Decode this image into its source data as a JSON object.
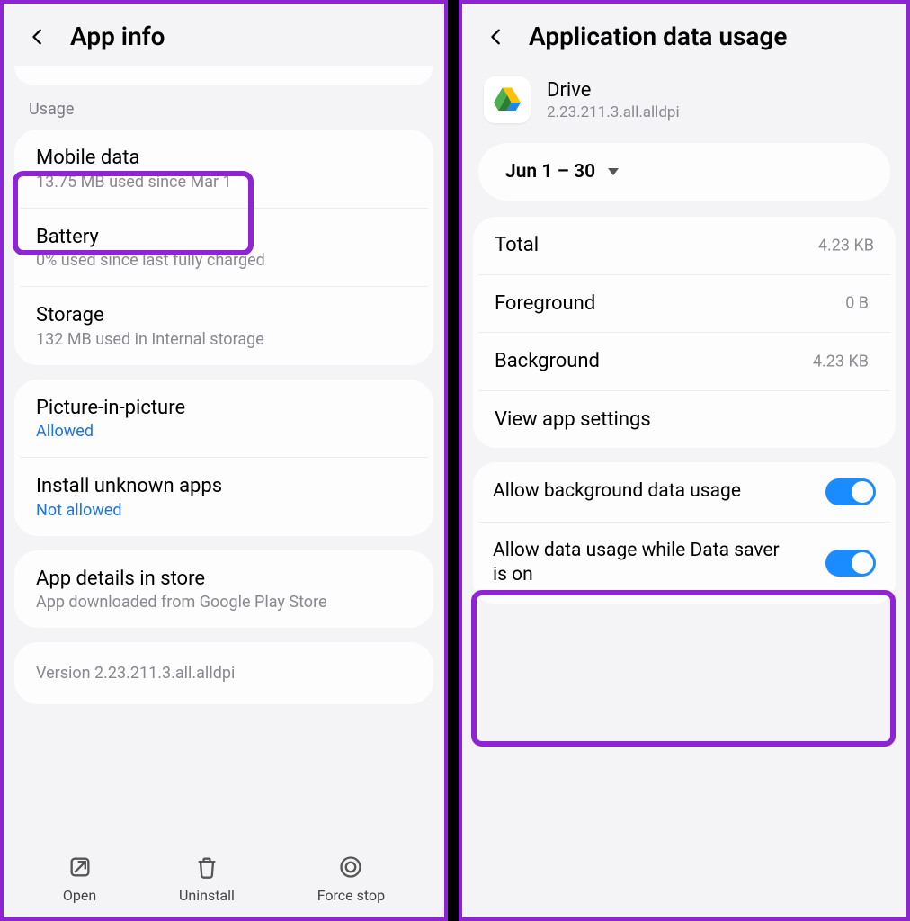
{
  "left": {
    "header_title": "App info",
    "section_label": "Usage",
    "mobile_data": {
      "title": "Mobile data",
      "sub": "13.75 MB used since Mar 1"
    },
    "battery": {
      "title": "Battery",
      "sub": "0% used since last fully charged"
    },
    "storage": {
      "title": "Storage",
      "sub": "132 MB used in Internal storage"
    },
    "pip": {
      "title": "Picture-in-picture",
      "sub": "Allowed"
    },
    "unknown": {
      "title": "Install unknown apps",
      "sub": "Not allowed"
    },
    "store": {
      "title": "App details in store",
      "sub": "App downloaded from Google Play Store"
    },
    "version": "Version 2.23.211.3.all.alldpi",
    "bottom": {
      "open": "Open",
      "uninstall": "Uninstall",
      "force_stop": "Force stop"
    }
  },
  "right": {
    "header_title": "Application data usage",
    "app": {
      "name": "Drive",
      "version": "2.23.211.3.all.alldpi"
    },
    "date_range": "Jun 1 – 30",
    "rows": {
      "total": {
        "label": "Total",
        "value": "4.23 KB"
      },
      "foreground": {
        "label": "Foreground",
        "value": "0 B"
      },
      "background": {
        "label": "Background",
        "value": "4.23 KB"
      },
      "view_settings": "View app settings"
    },
    "toggles": {
      "bg_data": "Allow background data usage",
      "data_saver": "Allow data usage while Data saver is on"
    }
  }
}
